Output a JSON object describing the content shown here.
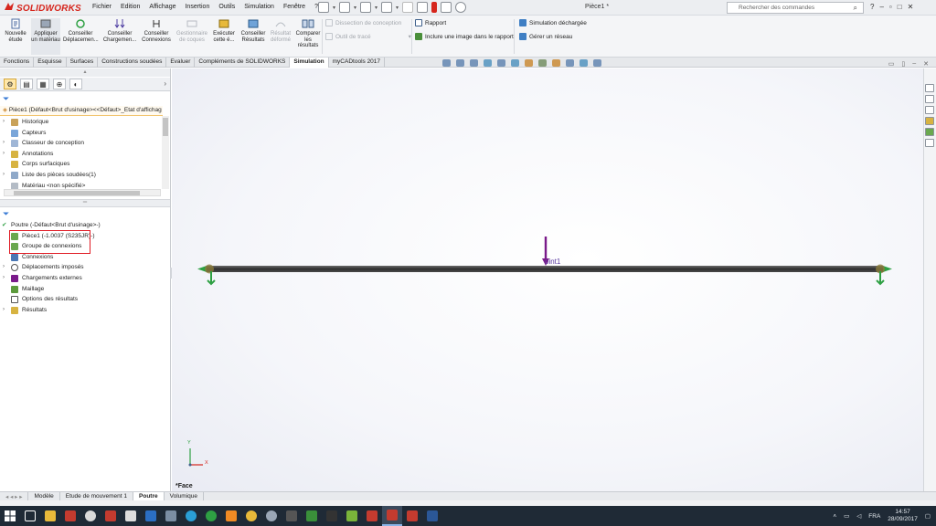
{
  "app": {
    "brand": "SOLIDWORKS",
    "doc_title": "Pièce1 *",
    "search_placeholder": "Rechercher des commandes",
    "help_label": "?"
  },
  "menu": [
    "Fichier",
    "Edition",
    "Affichage",
    "Insertion",
    "Outils",
    "Simulation",
    "Fenêtre"
  ],
  "menu_pin": "?",
  "ribbon": {
    "buttons": [
      {
        "label": "Nouvelle étude",
        "disabled": false
      },
      {
        "label": "Appliquer un matériau",
        "disabled": false
      },
      {
        "label": "Conseiller Déplacemen...",
        "disabled": false
      },
      {
        "label": "Conseiller Chargemen...",
        "disabled": false
      },
      {
        "label": "Conseiller Connexions",
        "disabled": false
      },
      {
        "label": "Gestionnaire de coques",
        "disabled": true
      },
      {
        "label": "Exécuter cette é...",
        "disabled": false
      },
      {
        "label": "Conseiller Résultats",
        "disabled": false
      },
      {
        "label": "Résultat déformé",
        "disabled": true
      },
      {
        "label": "Comparer les résultats",
        "disabled": false
      }
    ],
    "small": {
      "dissection": "Dissection de conception",
      "trace": "Outil de tracé",
      "rapport": "Rapport",
      "inclure": "Inclure une image dans le rapport",
      "sim_dechargee": "Simulation déchargée",
      "gerer_reseau": "Gérer un réseau"
    }
  },
  "command_tabs": [
    "Fonctions",
    "Esquisse",
    "Surfaces",
    "Constructions soudées",
    "Evaluer",
    "Compléments de SOLIDWORKS",
    "Simulation",
    "myCADtools 2017"
  ],
  "active_command_tab": "Simulation",
  "feature_tree": {
    "root": "Pièce1  (Défaut<Brut d'usinage><<Défaut>_Etat d'affichag",
    "items": [
      {
        "label": "Historique",
        "expandable": true
      },
      {
        "label": "Capteurs",
        "expandable": false
      },
      {
        "label": "Classeur de conception",
        "expandable": true
      },
      {
        "label": "Annotations",
        "expandable": true
      },
      {
        "label": "Corps surfaciques",
        "expandable": false
      },
      {
        "label": "Liste des pièces soudées(1)",
        "expandable": true
      },
      {
        "label": "Matériau <non spécifié>",
        "expandable": false
      }
    ]
  },
  "study_tree": {
    "root": "Poutre (-Défaut<Brut d'usinage>-)",
    "items": [
      {
        "label": "Pièce1 (-1.0037 (S235JR)-)",
        "expandable": false,
        "highlighted": true
      },
      {
        "label": "Groupe de connexions",
        "expandable": false,
        "highlighted": true
      },
      {
        "label": "Connexions",
        "expandable": false
      },
      {
        "label": "Déplacements imposés",
        "expandable": true
      },
      {
        "label": "Chargements externes",
        "expandable": true
      },
      {
        "label": "Maillage",
        "expandable": false
      },
      {
        "label": "Options des résultats",
        "expandable": false
      },
      {
        "label": "Résultats",
        "expandable": true
      }
    ]
  },
  "viewport": {
    "joint_label": "oint1",
    "view_label": "*Face",
    "axis_x": "X",
    "axis_y": "Y"
  },
  "bottom_tabs": [
    "Modèle",
    "Etude de mouvement 1",
    "Poutre",
    "Volumique"
  ],
  "active_bottom_tab": "Poutre",
  "taskbar": {
    "lang": "FRA",
    "time": "14:57",
    "date": "28/09/2017"
  },
  "colors": {
    "brand_red": "#d6261d",
    "highlight_box": "#e01b24",
    "load_arrow": "#7a1a8a",
    "fixture_green": "#2ea043",
    "beam": "#3a3a3a"
  }
}
